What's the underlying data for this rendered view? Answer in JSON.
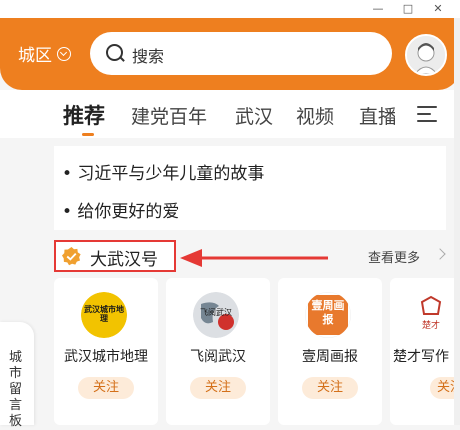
{
  "window": {
    "minimize_glyph": "—",
    "maximize_glyph": "□",
    "close_glyph": "✕"
  },
  "header": {
    "city_label": "城区",
    "search_placeholder": "搜索",
    "accent_color": "#ee7f1f"
  },
  "tabs": [
    {
      "label": "推荐",
      "active": true
    },
    {
      "label": "建党百年",
      "active": false
    },
    {
      "label": "武汉",
      "active": false
    },
    {
      "label": "视频",
      "active": false
    },
    {
      "label": "直播",
      "active": false
    }
  ],
  "news": [
    {
      "text": "• 习近平与少年儿童的故事"
    },
    {
      "text": "• 给你更好的爱"
    }
  ],
  "section": {
    "title": "大武汉号",
    "more_label": "查看更多",
    "highlight_color": "#e53935"
  },
  "accounts": [
    {
      "name": "武汉城市地理",
      "follow_label": "关注",
      "logo_text": "武汉城市地理",
      "logo_icon": "wuhan-city-geo-logo"
    },
    {
      "name": "飞阅武汉",
      "follow_label": "关注",
      "logo_text": "飞阅武汉",
      "logo_icon": "feiyue-wuhan-logo"
    },
    {
      "name": "壹周画报",
      "follow_label": "关注",
      "logo_text": "壹周画报",
      "logo_icon": "yizhou-huabao-logo"
    },
    {
      "name": "楚才写作",
      "follow_label": "关注",
      "logo_text": "楚才",
      "logo_icon": "chucai-logo"
    }
  ],
  "side_tab": {
    "label": "城市留言板"
  }
}
